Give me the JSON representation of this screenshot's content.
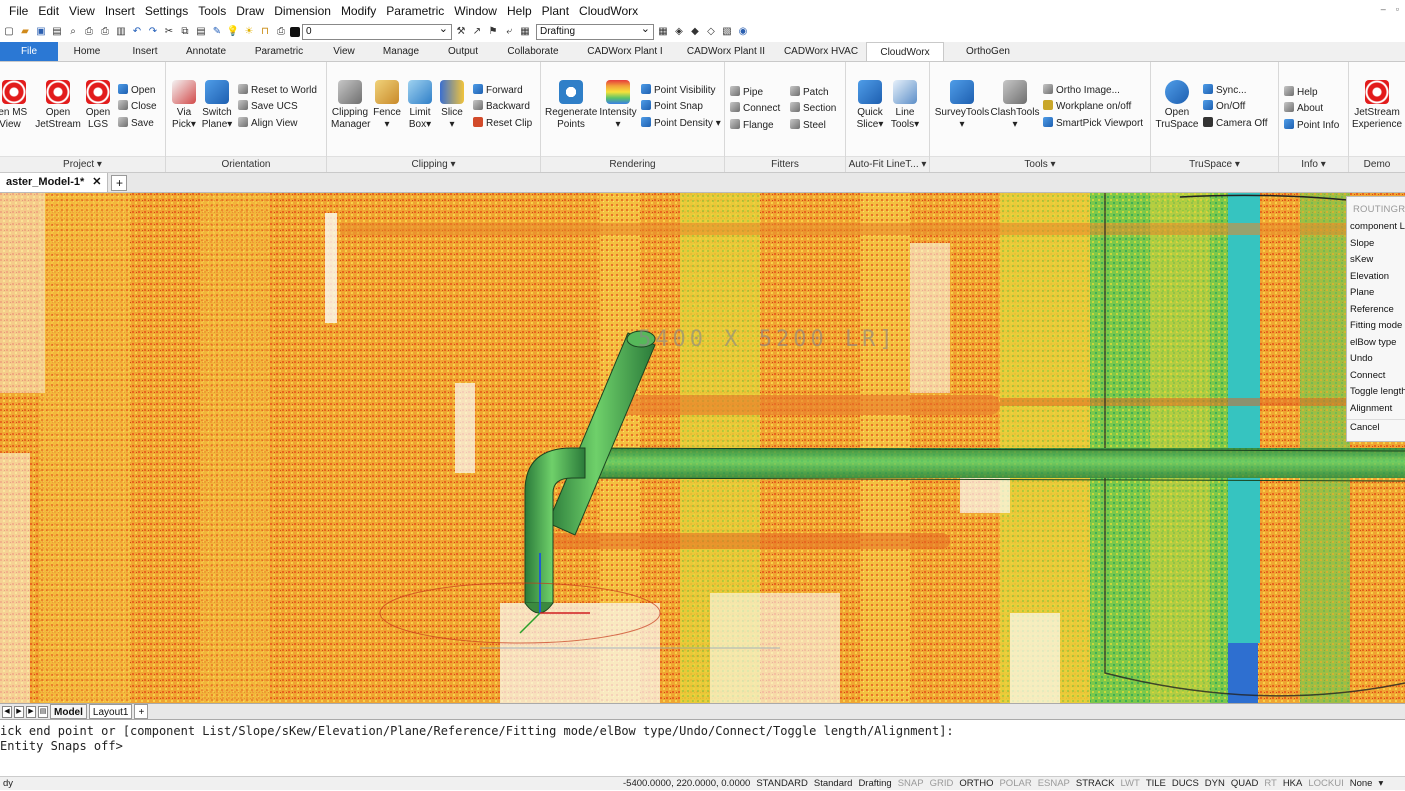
{
  "menu": [
    "File",
    "Edit",
    "View",
    "Insert",
    "Settings",
    "Tools",
    "Draw",
    "Dimension",
    "Modify",
    "Parametric",
    "Window",
    "Help",
    "Plant",
    "CloudWorx"
  ],
  "quick_access": {
    "layer_value": "0",
    "workspace_value": "Drafting"
  },
  "ribbon_tabs": [
    "File",
    "Home",
    "Insert",
    "Annotate",
    "Parametric",
    "View",
    "Manage",
    "Output",
    "Collaborate",
    "CADWorx Plant I",
    "CADWorx Plant II",
    "CADWorx HVAC",
    "CloudWorx",
    "OrthoGen"
  ],
  "active_tab": "CloudWorx",
  "panels": {
    "project": {
      "title": "Project ▾",
      "btn1": "pen MS\nView",
      "btn2": "Open\nJetStream",
      "btn3": "Open\nLGS",
      "open": "Open",
      "close": "Close",
      "save": "Save"
    },
    "orientation": {
      "title": "Orientation",
      "via": "Via\nPick▾",
      "switch": "Switch\nPlane▾",
      "reset": "Reset to World",
      "saveucs": "Save UCS",
      "align": "Align View"
    },
    "clipping": {
      "title": "Clipping ▾",
      "manager": "Clipping\nManager",
      "fence": "Fence\n▾",
      "limit": "Limit\nBox▾",
      "slice": "Slice\n▾",
      "forward": "Forward",
      "backward": "Backward",
      "resetclip": "Reset Clip"
    },
    "rendering": {
      "title": "Rendering",
      "regen": "Regenerate\nPoints",
      "intensity": "Intensity\n▾",
      "pv": "Point Visibility",
      "ps": "Point Snap",
      "pd": "Point Density ▾"
    },
    "fitters": {
      "title": "Fitters",
      "pipe": "Pipe",
      "connect": "Connect",
      "flange": "Flange",
      "patch": "Patch",
      "section": "Section",
      "steel": "Steel"
    },
    "autofit": {
      "title": "Auto-Fit LineT... ▾",
      "quick": "Quick\nSlice▾",
      "line": "Line\nTools▾"
    },
    "tools": {
      "title": "Tools ▾",
      "survey": "SurveyTools\n▾",
      "clash": "ClashTools\n▾",
      "ortho": "Ortho Image...",
      "workplane": "Workplane on/off",
      "smartpick": "SmartPick Viewport"
    },
    "truspace": {
      "title": "TruSpace ▾",
      "open": "Open\nTruSpace",
      "sync": "Sync...",
      "onoff": "On/Off",
      "camera": "Camera Off"
    },
    "info": {
      "title": "Info ▾",
      "help": "Help",
      "about": "About",
      "pointinfo": "Point Info"
    },
    "demo": {
      "title": "Demo",
      "jet": "JetStream\nExperience"
    }
  },
  "document_tab": "aster_Model-1*",
  "viewport_label": "5400 X 5200 LR]",
  "routing_menu": {
    "title": "ROUTINGR",
    "items": [
      "component Li",
      "Slope",
      "sKew",
      "Elevation",
      "Plane",
      "Reference",
      "Fitting mode",
      "elBow type",
      "Undo",
      "Connect",
      "Toggle length",
      "Alignment"
    ],
    "cancel": "Cancel"
  },
  "layout_tabs": [
    "Model",
    "Layout1",
    "+"
  ],
  "command_lines": [
    "ick end point or [component List/Slope/sKew/Elevation/Plane/Reference/Fitting mode/elBow type/Undo/Connect/Toggle length/Alignment]:",
    "Entity Snaps off>"
  ],
  "status": {
    "left": "dy",
    "coords": "-5400.0000, 220.0000, 0.0000",
    "items": [
      {
        "t": "STANDARD",
        "on": true
      },
      {
        "t": "Standard",
        "on": true
      },
      {
        "t": "Drafting",
        "on": true
      },
      {
        "t": "SNAP",
        "on": false
      },
      {
        "t": "GRID",
        "on": false
      },
      {
        "t": "ORTHO",
        "on": true
      },
      {
        "t": "POLAR",
        "on": false
      },
      {
        "t": "ESNAP",
        "on": false
      },
      {
        "t": "STRACK",
        "on": true
      },
      {
        "t": "LWT",
        "on": false
      },
      {
        "t": "TILE",
        "on": true
      },
      {
        "t": "DUCS",
        "on": true
      },
      {
        "t": "DYN",
        "on": true
      },
      {
        "t": "QUAD",
        "on": true
      },
      {
        "t": "RT",
        "on": false
      },
      {
        "t": "HKA",
        "on": true
      },
      {
        "t": "LOCKUI",
        "on": false
      },
      {
        "t": "None",
        "on": true
      }
    ]
  }
}
